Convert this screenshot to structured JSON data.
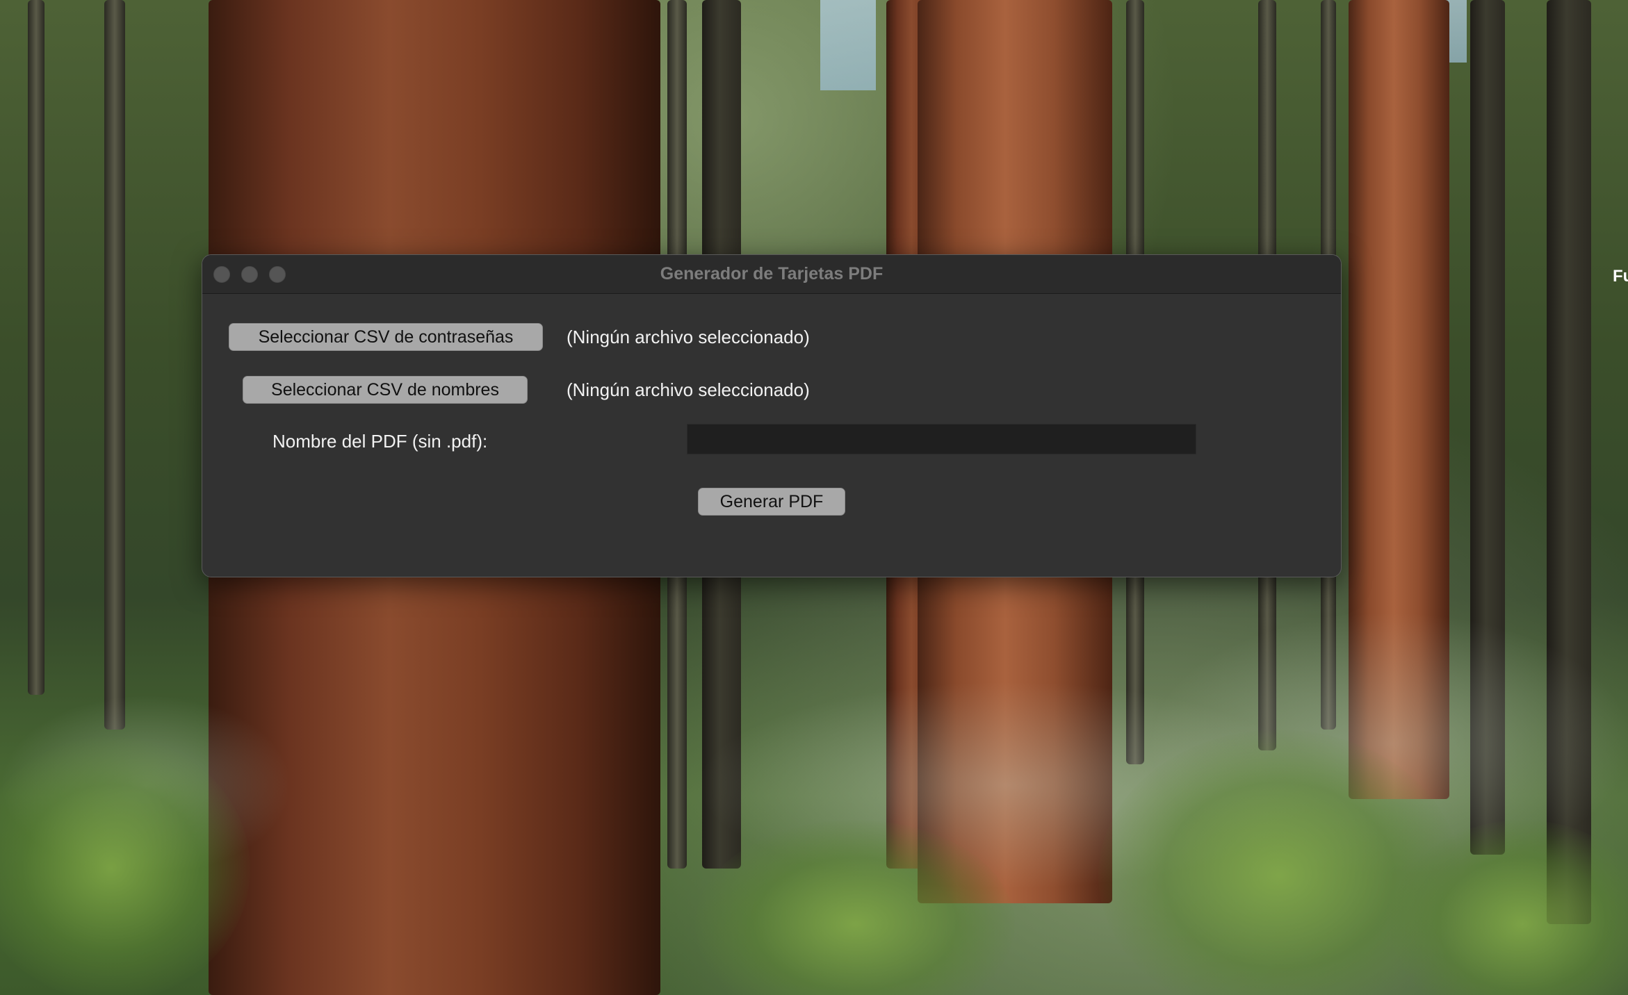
{
  "window": {
    "title": "Generador de Tarjetas PDF"
  },
  "form": {
    "select_passwords_label": "Seleccionar CSV de contraseñas",
    "passwords_status": "(Ningún archivo seleccionado)",
    "select_names_label": "Seleccionar CSV de nombres",
    "names_status": "(Ningún archivo seleccionado)",
    "pdf_name_label": "Nombre del PDF (sin .pdf):",
    "pdf_name_value": "",
    "generate_label": "Generar PDF"
  },
  "desktop": {
    "edge_text": "Fu"
  },
  "colors": {
    "window_bg": "#323232",
    "titlebar_bg": "#2b2b2b",
    "button_bg": "#a8a8a8",
    "input_bg": "#1f1f1f"
  }
}
